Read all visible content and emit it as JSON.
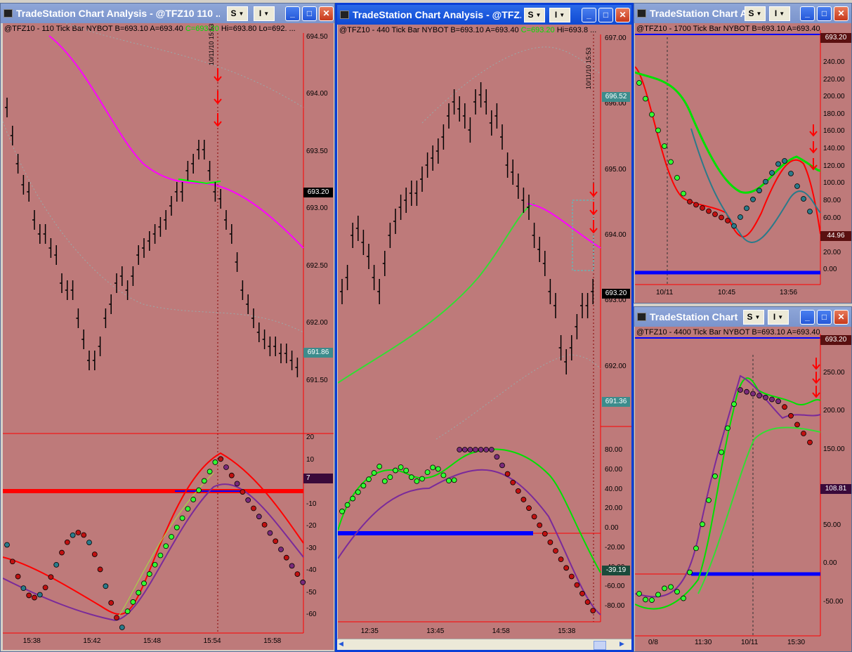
{
  "windows": [
    {
      "title": "TradeStation Chart Analysis - @TFZ10 110 ...",
      "symbol": "@TFZ10 - 110 Tick Bar",
      "exchange": "NYBOT",
      "bid": "B=693.10",
      "ask": "A=693.40",
      "ask_green": "C=693.20",
      "hi": "Hi=693.80",
      "lo": "Lo=692. ...",
      "date_marker": "10/11/10 15:53",
      "price_ticks": [
        "694.50",
        "694.00",
        "693.50",
        "693.00",
        "692.50",
        "692.00",
        "691.50"
      ],
      "last_price_label": "693.20",
      "ma_price_label": "691.86",
      "osc_ticks": [
        "20",
        "10",
        "0",
        "-10",
        "-20",
        "-30",
        "-40",
        "-50",
        "-60"
      ],
      "osc_value_label": "7",
      "time_ticks": [
        "15:38",
        "15:42",
        "15:48",
        "15:54",
        "15:58"
      ]
    },
    {
      "title": "TradeStation Chart Analysis - @TFZ...",
      "symbol": "@TFZ10 - 440 Tick Bar",
      "exchange": "NYBOT",
      "bid": "B=693.10",
      "ask": "A=693.40",
      "ask_green": "C=693.20",
      "hi": "Hi=693.8 ...",
      "date_marker": "10/11/10 15:53",
      "price_ticks": [
        "697.00",
        "696.00",
        "695.00",
        "694.00",
        "693.00",
        "692.00"
      ],
      "upper_label": "696.52",
      "last_price_label": "693.20",
      "ma_price_label": "691.36",
      "osc_ticks": [
        "80.00",
        "60.00",
        "40.00",
        "20.00",
        "0.00",
        "-20.00",
        "-40.00",
        "-60.00",
        "-80.00"
      ],
      "osc_value_label": "-39.19",
      "time_ticks": [
        "12:35",
        "13:45",
        "14:58",
        "15:38"
      ]
    },
    {
      "title": "TradeStation Chart A...",
      "infobar": "@TFZ10 - 1700 Tick Bar NYBOT B=693.10 A=693.40",
      "top_label": "693.20",
      "osc_ticks": [
        "240.00",
        "220.00",
        "200.00",
        "180.00",
        "160.00",
        "140.00",
        "120.00",
        "100.00",
        "80.00",
        "60.00",
        "40.00",
        "20.00",
        "0.00"
      ],
      "osc_value_label": "44.96",
      "time_ticks": [
        "10/11",
        "10:45",
        "13:56"
      ]
    },
    {
      "title": "TradeStation Chart ...",
      "infobar": "@TFZ10 - 4400 Tick Bar NYBOT B=693.10 A=693.40",
      "top_label": "693.20",
      "osc_ticks": [
        "250.00",
        "200.00",
        "150.00",
        "100.00",
        "50.00",
        "0.00",
        "-50.00"
      ],
      "osc_value_label": "108.81",
      "time_ticks": [
        "0/8",
        "11:30",
        "10/11",
        "15:30"
      ]
    }
  ],
  "buttons": {
    "s": "S",
    "i": "I"
  },
  "colors": {
    "panel": "#be7a7a",
    "axis_red": "#ff0000",
    "magenta": "#ff00ff",
    "green": "#00ff00",
    "blue": "#0000ff"
  }
}
